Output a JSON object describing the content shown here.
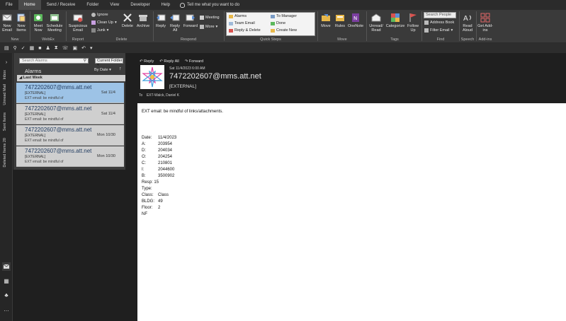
{
  "menu": {
    "tabs": [
      "File",
      "Home",
      "Send / Receive",
      "Folder",
      "View",
      "Developer",
      "Help"
    ],
    "active_index": 1,
    "tell_me": "Tell me what you want to do"
  },
  "ribbon": {
    "new_email": "New Email",
    "new_items": "New Items",
    "meet_now": "Meet Now",
    "schedule_meeting": "Schedule Meeting",
    "suspicious_email": "Suspicious Email",
    "ignore": "Ignore",
    "clean_up": "Clean Up",
    "junk": "Junk",
    "delete": "Delete",
    "archive": "Archive",
    "reply": "Reply",
    "reply_all": "Reply All",
    "forward": "Forward",
    "meeting": "Meeting",
    "more": "More",
    "quick_steps": {
      "alarms": "Alarms",
      "to_manager": "To Manager",
      "team_email": "Team Email",
      "done": "Done",
      "reply_delete": "Reply & Delete",
      "create_new": "Create New"
    },
    "move": "Move",
    "rules": "Rules",
    "onenote": "OneNote",
    "unread_read": "Unread/ Read",
    "categorize": "Categorize",
    "follow_up": "Follow Up",
    "search_people_placeholder": "Search People",
    "address_book": "Address Book",
    "filter_email": "Filter Email",
    "read_aloud": "Read Aloud",
    "get_addins": "Get Add-ins",
    "groups": {
      "new": "New",
      "webex": "WebEx",
      "report": "Report",
      "delete": "Delete",
      "respond": "Respond",
      "quick_steps": "Quick Steps",
      "move": "Move",
      "tags": "Tags",
      "find": "Find",
      "speech": "Speech",
      "addins": "Add-ins"
    }
  },
  "nav": {
    "inbox": "Inbox",
    "unread_mail": "Unread Mail",
    "sent_items": "Sent Items",
    "deleted_items": "Deleted Items",
    "deleted_count": "20"
  },
  "list": {
    "search_placeholder": "Search Alarms",
    "scope": "Current Folder",
    "folder": "Alarms",
    "sort": "By Date",
    "group": "Last Week",
    "items": [
      {
        "from": "7472202607@mms.att.net",
        "tag": "[EXTERNAL]",
        "preview": "EXT email: be mindful of",
        "date": "Sat 11/4",
        "selected": true
      },
      {
        "from": "7472202607@mms.att.net",
        "tag": "[EXTERNAL]",
        "preview": "EXT email: be mindful of",
        "date": "Sat 11/4",
        "selected": false
      },
      {
        "from": "7472202607@mms.att.net",
        "tag": "[EXTERNAL]",
        "preview": "EXT email: be mindful of",
        "date": "Mon 10/30",
        "selected": false
      },
      {
        "from": "7472202607@mms.att.net",
        "tag": "[EXTERNAL]",
        "preview": "EXT email: be mindful of",
        "date": "Mon 10/30",
        "selected": false
      }
    ]
  },
  "reading": {
    "reply": "Reply",
    "reply_all": "Reply All",
    "forward": "Forward",
    "sent": "Sat 11/4/2023 6:00 AM",
    "sender": "7472202607@mms.att.net",
    "tag": "[EXTERNAL]",
    "to_label": "To",
    "to": "EXT-Walck, Daniel K",
    "banner": "EXT email: be mindful of links/attachments.",
    "fields": [
      {
        "k": "Date:",
        "v": "11/4/2023"
      },
      {
        "k": "A:",
        "v": "203954"
      },
      {
        "k": "D:",
        "v": "204034"
      },
      {
        "k": "O:",
        "v": "204254"
      },
      {
        "k": "C:",
        "v": "210801"
      },
      {
        "k": "I:",
        "v": "2044600"
      },
      {
        "k": "B:",
        "v": "3500902"
      },
      {
        "k": "Resp:",
        "v": "15"
      },
      {
        "k": "Type:",
        "v": ""
      },
      {
        "k": "Class:",
        "v": "Class"
      },
      {
        "k": "BLDG:",
        "v": "49"
      },
      {
        "k": "Floor:",
        "v": "2"
      },
      {
        "k": "NF",
        "v": ""
      }
    ]
  }
}
